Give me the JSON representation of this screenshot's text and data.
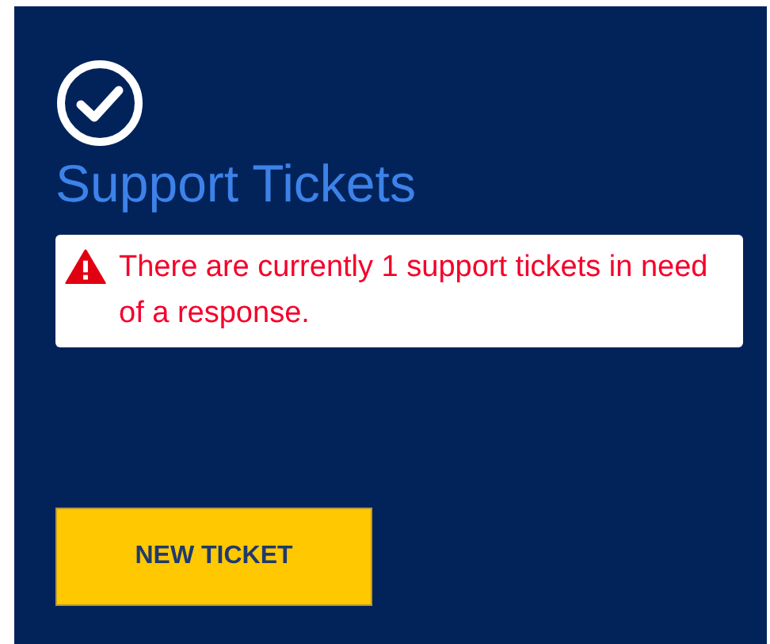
{
  "card": {
    "title": "Support Tickets",
    "alert": {
      "kind": "warning",
      "message": "There are currently 1 support tickets in need of a response."
    },
    "button": "NEW TICKET"
  }
}
